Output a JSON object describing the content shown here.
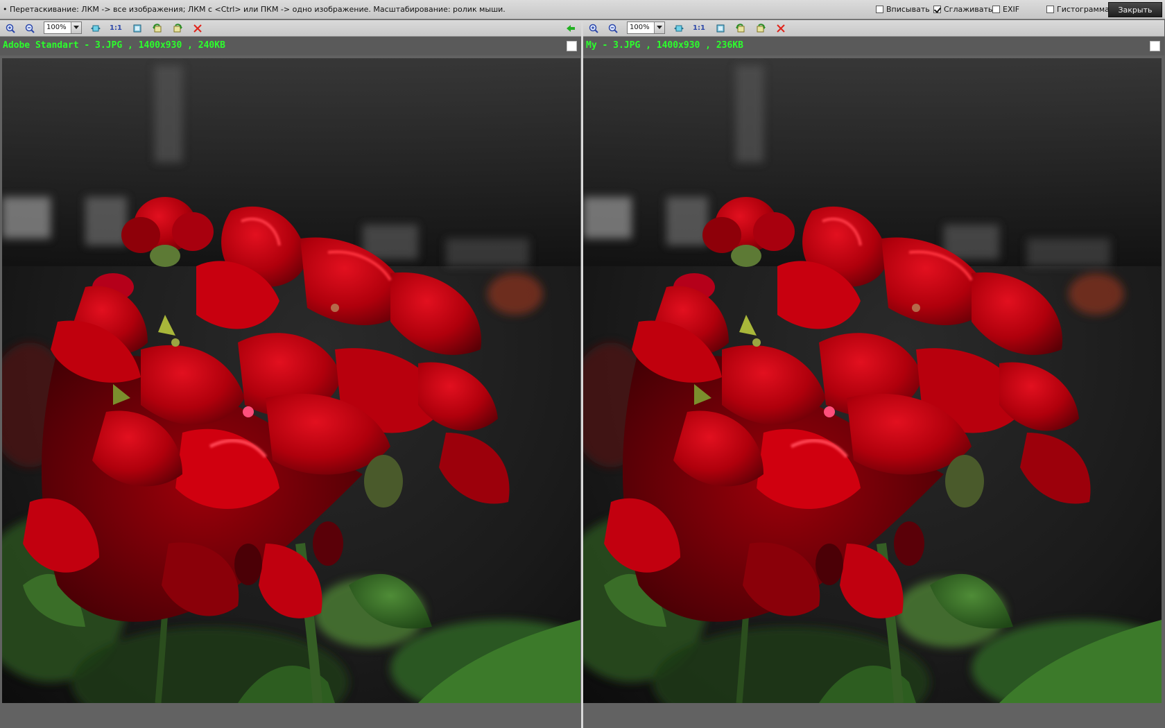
{
  "topbar": {
    "hint": "• Перетаскивание: ЛКМ -> все изображения; ЛКМ с <Ctrl> или ПКМ -> одно изображение. Масштабирование: ролик мыши.",
    "options": [
      {
        "label": "Вписывать",
        "checked": false
      },
      {
        "label": "Сглаживать",
        "checked": true
      },
      {
        "label": "EXIF",
        "checked": false
      },
      {
        "label": "Гистограмма",
        "checked": false
      }
    ],
    "close_label": "Закрыть"
  },
  "panes": [
    {
      "zoom": "100%",
      "info": "Adobe Standart - 3.JPG , 1400x930 , 240KB",
      "icons": [
        "zoom-in-icon",
        "zoom-out-icon",
        "fit-icon",
        "actual-size-icon",
        "fit-window-icon",
        "rotate-left-icon",
        "rotate-right-icon",
        "close-image-icon",
        "arrow-left-icon"
      ],
      "actual_size_label": "1:1"
    },
    {
      "zoom": "100%",
      "info": "My - 3.JPG , 1400x930 , 236KB",
      "icons": [
        "zoom-in-icon",
        "zoom-out-icon",
        "fit-icon",
        "actual-size-icon",
        "fit-window-icon",
        "rotate-left-icon",
        "rotate-right-icon",
        "close-image-icon"
      ],
      "actual_size_label": "1:1"
    }
  ],
  "colors": {
    "info_text": "#2cff2c",
    "petal_red": "#c1000f",
    "leaf_green": "#2e6b22"
  }
}
